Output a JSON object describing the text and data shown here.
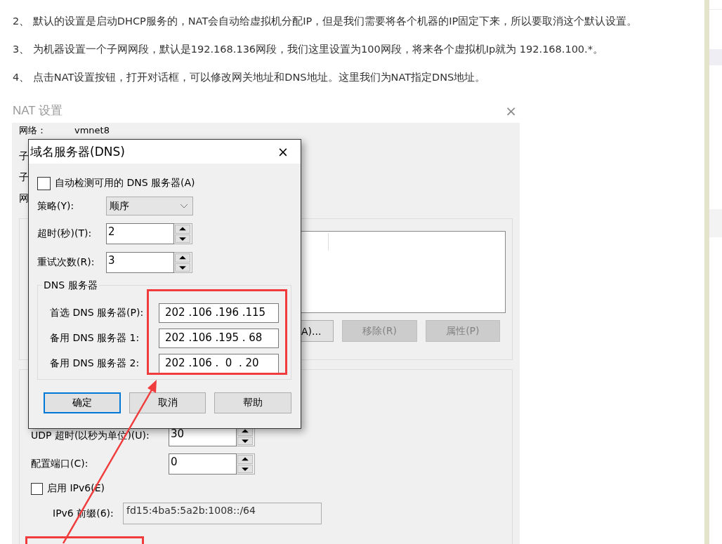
{
  "paragraphs": [
    "2、 默认的设置是启动DHCP服务的，NAT会自动给虚拟机分配IP，但是我们需要将各个机器的IP固定下来，所以要取消这个默认设置。",
    "3、 为机器设置一个子网网段，默认是192.168.136网段，我们这里设置为100网段，将来各个虚拟机Ip就为 192.168.100.*。",
    "4、 点击NAT设置按钮，打开对话框，可以修改网关地址和DNS地址。这里我们为NAT指定DNS地址。"
  ],
  "nat_dialog": {
    "title": "NAT 设置",
    "close": "×",
    "labels": [
      "网络：",
      "子",
      "子",
      "网"
    ],
    "network_value": "vmnet8",
    "buttons": [
      {
        "label": "A)...",
        "disabled": false
      },
      {
        "label": "移除(R)",
        "disabled": true
      },
      {
        "label": "属性(P)",
        "disabled": true
      }
    ],
    "udp_timeout": {
      "label": "UDP 超时(以秒为单位)(U):",
      "value": "30"
    },
    "config_port": {
      "label": "配置端口(C):",
      "value": "0"
    },
    "ipv6": {
      "label": "启用 IPv6(E)",
      "checked": false
    },
    "ipv6_prefix": {
      "label": "IPv6 前缀(6):",
      "value": "fd15:4ba5:5a2b:1008::/64"
    }
  },
  "dns_dialog": {
    "title": "域名服务器(DNS)",
    "close": "×",
    "auto_detect": {
      "label": "自动检测可用的 DNS 服务器(A)",
      "checked": false
    },
    "policy": {
      "label": "策略(Y):",
      "value": "顺序"
    },
    "timeout": {
      "label": "超时(秒)(T):",
      "value": "2"
    },
    "retries": {
      "label": "重试次数(R):",
      "value": "3"
    },
    "group_title": "DNS 服务器",
    "servers": [
      {
        "label": "首选 DNS 服务器(P):",
        "value": "202 .106 .196 .115"
      },
      {
        "label": "备用 DNS 服务器 1:",
        "value": "202 .106 .195 . 68"
      },
      {
        "label": "备用 DNS 服务器 2:",
        "value": "202 .106 .  0  . 20"
      }
    ],
    "buttons": [
      {
        "label": "确定",
        "default": true
      },
      {
        "label": "取消",
        "default": false
      },
      {
        "label": "帮助",
        "default": false
      }
    ]
  }
}
